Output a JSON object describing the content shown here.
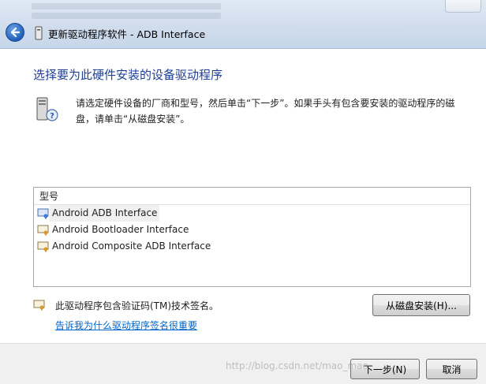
{
  "window": {
    "title": "更新驱动程序软件 - ADB Interface",
    "back_icon": "back-arrow-icon"
  },
  "main": {
    "heading": "选择要为此硬件安装的设备驱动程序",
    "instruction": "请选定硬件设备的厂商和型号，然后单击“下一步”。如果手头有包含要安装的驱动程序的磁盘，请单击“从磁盘安装”。",
    "model_list": {
      "header": "型号",
      "items": [
        {
          "label": "Android ADB Interface",
          "selected": true
        },
        {
          "label": "Android Bootloader Interface",
          "selected": false
        },
        {
          "label": "Android Composite ADB Interface",
          "selected": false
        }
      ]
    },
    "signature_text": "此驱动程序包含验证码(TM)技术签名。",
    "have_disk_button": "从磁盘安装(H)...",
    "why_link": "告诉我为什么驱动程序签名很重要"
  },
  "footer": {
    "next_button": "下一步(N)",
    "cancel_button": "取消"
  },
  "watermark": "http://blog.csdn.net/mao_mao",
  "colors": {
    "heading": "#1e3f99",
    "link": "#0066cc",
    "accent": "#1f5fb8"
  }
}
